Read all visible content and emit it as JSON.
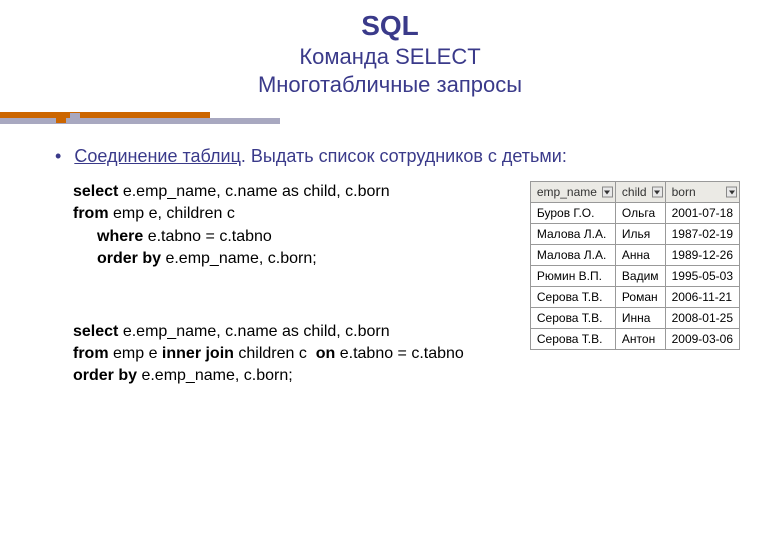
{
  "header": {
    "title": "SQL",
    "subtitle1": "Команда SELECT",
    "subtitle2": "Многотабличные запросы"
  },
  "bullet": {
    "text_underlined": "Соединение таблиц",
    "text_rest": ". Выдать список сотрудников с детьми:"
  },
  "code1": {
    "kw_select": "select",
    "l1_rest": " e.emp_name, c.name as child, c.born",
    "kw_from": "from",
    "l2_rest": " emp e, children c",
    "kw_where": "where",
    "l3_rest": " e.tabno = c.tabno",
    "kw_order": "order by",
    "l4_rest": " e.emp_name, c.born;"
  },
  "code2": {
    "kw_select": "select",
    "l1_rest": " e.emp_name, c.name as child, c.born",
    "kw_from": "from",
    "l2_mid": " emp e ",
    "kw_inner": "inner join",
    "l2_mid2": " children c  ",
    "kw_on": "on",
    "l2_rest": " e.tabno = c.tabno",
    "kw_order": "order by",
    "l3_rest": " e.emp_name, c.born;"
  },
  "table": {
    "headers": [
      "emp_name",
      "child",
      "born"
    ],
    "rows": [
      {
        "emp_name": "Буров Г.О.",
        "child": "Ольга",
        "born": "2001-07-18"
      },
      {
        "emp_name": "Малова Л.А.",
        "child": "Илья",
        "born": "1987-02-19"
      },
      {
        "emp_name": "Малова Л.А.",
        "child": "Анна",
        "born": "1989-12-26"
      },
      {
        "emp_name": "Рюмин В.П.",
        "child": "Вадим",
        "born": "1995-05-03"
      },
      {
        "emp_name": "Серова Т.В.",
        "child": "Роман",
        "born": "2006-11-21"
      },
      {
        "emp_name": "Серова Т.В.",
        "child": "Инна",
        "born": "2008-01-25"
      },
      {
        "emp_name": "Серова Т.В.",
        "child": "Антон",
        "born": "2009-03-06"
      }
    ]
  }
}
